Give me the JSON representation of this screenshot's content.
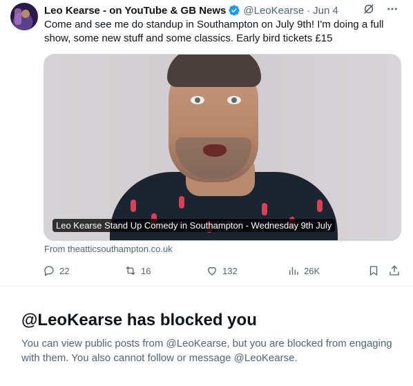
{
  "tweet": {
    "author_name": "Leo Kearse - on YouTube & GB News",
    "handle": "@LeoKearse",
    "separator": "·",
    "date": "Jun 4",
    "text": "Come and see me do standup in Southampton on July 9th! I'm doing a full show, some new stuff and some classics. Early bird tickets £15",
    "card": {
      "caption": "Leo Kearse Stand Up Comedy in Southampton - Wednesday 9th July",
      "source": "From theatticsouthampton.co.uk"
    },
    "actions": {
      "replies": "22",
      "reposts": "16",
      "likes": "132",
      "views": "26K"
    }
  },
  "blocked": {
    "title": "@LeoKearse has blocked you",
    "message": "You can view public posts from @LeoKearse, but you are blocked from engaging with them. You also cannot follow or message @LeoKearse."
  },
  "colors": {
    "verified_blue": "#1d9bf0",
    "secondary_text": "#536471",
    "primary_text": "#0f1419"
  },
  "icons": [
    "verified-badge-icon",
    "grok-icon",
    "more-icon",
    "reply-icon",
    "repost-icon",
    "like-icon",
    "views-icon",
    "bookmark-icon",
    "share-icon"
  ]
}
